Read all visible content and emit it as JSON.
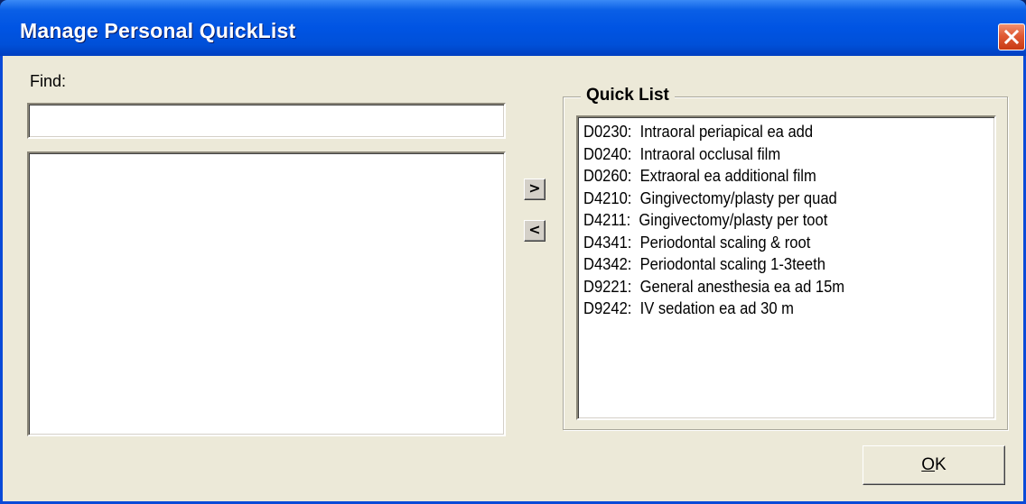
{
  "window": {
    "title": "Manage Personal QuickList",
    "close_icon": "close-icon"
  },
  "find": {
    "label": "Find:",
    "value": "",
    "placeholder": ""
  },
  "transfer": {
    "add_label": ">",
    "remove_label": "<"
  },
  "quick_list": {
    "title": "Quick List",
    "items": [
      {
        "code": "D0230:",
        "desc": "Intraoral periapical ea add"
      },
      {
        "code": "D0240:",
        "desc": "Intraoral occlusal film"
      },
      {
        "code": "D0260:",
        "desc": "Extraoral ea additional film"
      },
      {
        "code": "D4210:",
        "desc": "Gingivectomy/plasty per quad"
      },
      {
        "code": "D4211:",
        "desc": "Gingivectomy/plasty per toot"
      },
      {
        "code": "D4341:",
        "desc": "Periodontal scaling & root"
      },
      {
        "code": "D4342:",
        "desc": "Periodontal scaling 1-3teeth"
      },
      {
        "code": "D9221:",
        "desc": "General anesthesia ea ad 15m"
      },
      {
        "code": "D9242:",
        "desc": "IV sedation ea ad 30 m"
      }
    ]
  },
  "ok_button": {
    "mnemonic": "O",
    "rest": "K"
  },
  "colors": {
    "titlebar": "#0054e3",
    "face": "#ece9d8",
    "close_button": "#e05a34"
  }
}
